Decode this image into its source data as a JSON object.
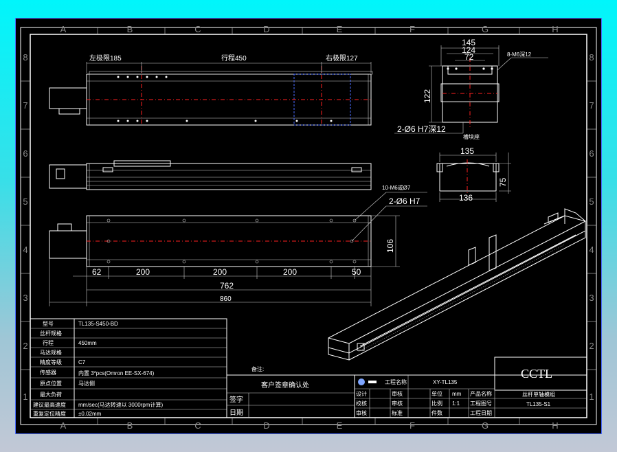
{
  "zones": {
    "columns": [
      "A",
      "B",
      "C",
      "D",
      "E",
      "F",
      "G",
      "H"
    ],
    "rows": [
      "8",
      "7",
      "6",
      "5",
      "4",
      "3",
      "2",
      "1"
    ]
  },
  "top_view": {
    "left_limit": "左极限185",
    "stroke": "行程450",
    "right_limit": "右极限127"
  },
  "end_view": {
    "dim_145": "145",
    "dim_124": "124",
    "dim_72": "72",
    "dim_122": "122",
    "tapped_holes": "8-M6深12",
    "dowel_holes": "2-Ø6 H7深12",
    "sensor_note": "槽块座"
  },
  "section_view": {
    "dim_135": "135",
    "dim_136": "136",
    "dim_75": "75"
  },
  "bottom_view": {
    "mount_holes": "10-M6或Ø7",
    "dowel": "2-Ø6 H7",
    "dim_106": "106",
    "dim_62": "62",
    "dim_200_a": "200",
    "dim_200_b": "200",
    "dim_200_c": "200",
    "dim_50": "50",
    "dim_762": "762",
    "dim_860": "860"
  },
  "spec_table": [
    {
      "label": "型号",
      "value": "TL135-S450-BD"
    },
    {
      "label": "丝杆规格",
      "value": ""
    },
    {
      "label": "行程",
      "value": "450mm"
    },
    {
      "label": "马达规格",
      "value": ""
    },
    {
      "label": "精度等级",
      "value": "C7"
    },
    {
      "label": "传感器",
      "value": "内置 3*pcs(Omron EE-SX-674)"
    },
    {
      "label": "原点位置",
      "value": "马达侧"
    },
    {
      "label": "最大负荷",
      "value": ""
    },
    {
      "label": "建议最高速度",
      "value": "mm/sec(马达转速以 3000rpm计算)"
    },
    {
      "label": "重复定位精度",
      "value": "±0.02mm"
    }
  ],
  "approval": {
    "note": "备注:",
    "customer_confirm": "客户签章确认处",
    "sign_label": "签字",
    "date_label": "日期"
  },
  "title_block": {
    "project_name_label": "工程名称",
    "project_name": "XY-TL135",
    "design_label": "设计",
    "review_label": "审核",
    "audit_label": "校核",
    "approve_label": "审核",
    "check_label": "审核",
    "standardize_label": "标准",
    "unit_label": "单位",
    "unit_value": "mm",
    "scale_label": "比例",
    "scale_value": "1:1",
    "qty_label": "件数",
    "product_name_label": "产品名称",
    "drawing_no_label": "工程图号",
    "drawing_date_label": "工程日期",
    "company": "CCTL",
    "product_name": "丝杆单轴模组",
    "drawing_no": "TL135-S1"
  }
}
